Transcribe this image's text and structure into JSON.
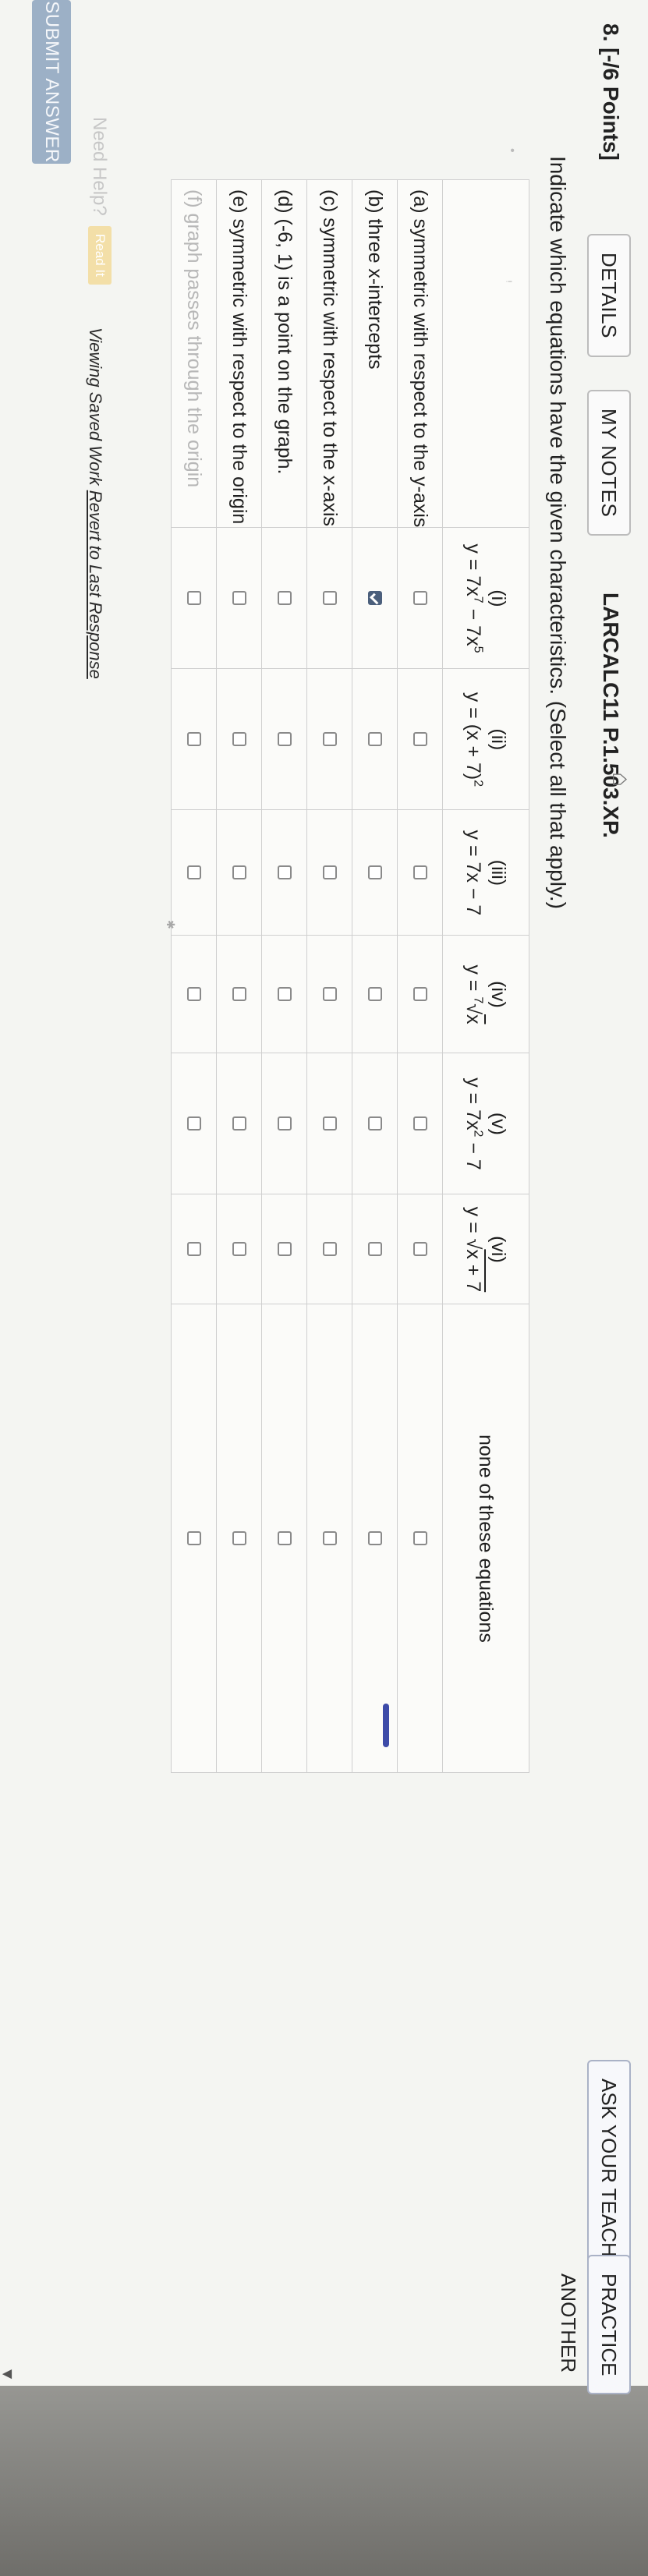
{
  "question": {
    "number_label": "8.  [-/6 Points]",
    "tabs": [
      "DETAILS",
      "MY NOTES"
    ],
    "code": "LARCALC11 P.1.503.XP.",
    "right_buttons": [
      "ASK YOUR TEACHER",
      "PRACTICE ANOTHER"
    ],
    "prompt": "Indicate which equations have the given characteristics. (Select all that apply.)"
  },
  "table": {
    "columns": [
      {
        "roman": "(i)",
        "eq_html": "y = 7x<span class=\"sup\">7</span> − 7x<span class=\"sup\">5</span>"
      },
      {
        "roman": "(ii)",
        "eq_html": "y = (x + 7)<span class=\"sup\">2</span>"
      },
      {
        "roman": "(iii)",
        "eq_html": "y = 7x − 7"
      },
      {
        "roman": "(iv)",
        "eq_html": "y = <span class=\"sup\">7</span>√<span class=\"rad\">x</span>"
      },
      {
        "roman": "(v)",
        "eq_html": "y = 7x<span class=\"sup\">2</span> − 7"
      },
      {
        "roman": "(vi)",
        "eq_html": "y = √<span class=\"rad\">x + 7</span>"
      },
      {
        "roman": "",
        "eq_html": "none of these equations"
      }
    ],
    "rows": [
      {
        "label": "(a) symmetric with respect to the y-axis",
        "checked": [
          false,
          false,
          false,
          false,
          false,
          false,
          false
        ],
        "faded": false
      },
      {
        "label": "(b) three x-intercepts",
        "checked": [
          true,
          false,
          false,
          false,
          false,
          false,
          false
        ],
        "faded": false
      },
      {
        "label": "(c) symmetric with respect to the x-axis",
        "checked": [
          false,
          false,
          false,
          false,
          false,
          false,
          false
        ],
        "faded": false
      },
      {
        "label": "(d)   (-6, 1) is a point on the graph.",
        "checked": [
          false,
          false,
          false,
          false,
          false,
          false,
          false
        ],
        "faded": false
      },
      {
        "label": "(e) symmetric with respect to the origin",
        "checked": [
          false,
          false,
          false,
          false,
          false,
          false,
          false
        ],
        "faded": false
      },
      {
        "label": "(f) graph passes through the origin",
        "checked": [
          false,
          false,
          false,
          false,
          false,
          false,
          false
        ],
        "faded": true
      }
    ]
  },
  "help": {
    "need_help": "Need Help?",
    "read_it": "Read It",
    "saved_prefix": "Viewing Saved Work ",
    "saved_link": "Revert to Last Response"
  },
  "submit_label": "SUBMIT ANSWER"
}
